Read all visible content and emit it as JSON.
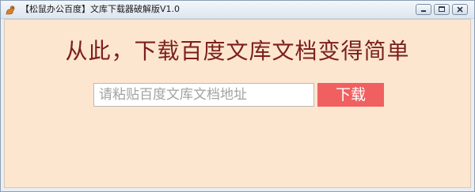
{
  "window": {
    "title": "【松鼠办公百度】文库下载器破解版V1.0",
    "icon": "squirrel-app-icon",
    "controls": [
      "minimize-icon",
      "maximize-icon",
      "close-icon"
    ]
  },
  "main": {
    "headline": "从此，下载百度文库文档变得简单",
    "url_input": {
      "placeholder": "请粘贴百度文库文档地址",
      "value": ""
    },
    "download_button_label": "下载"
  },
  "colors": {
    "client_background": "#fde6d0",
    "headline": "#7b1f1b",
    "download_button": "#f06060",
    "input_placeholder": "#a3a3a3"
  }
}
